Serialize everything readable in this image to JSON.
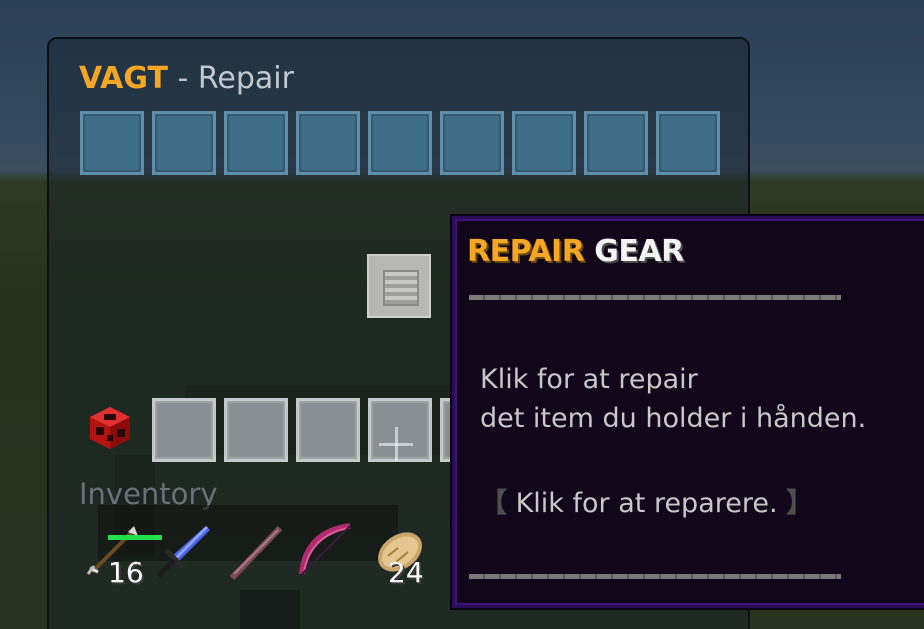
{
  "window": {
    "title_brand": "VAGT",
    "title_sep": "-",
    "title_sub": "Repair",
    "top_slot_count": 9
  },
  "center_button": {
    "icon": "stone-button-icon"
  },
  "inventory": {
    "label": "Inventory",
    "slot_count": 9,
    "side_icon": "tnt-icon"
  },
  "hotbar": {
    "items": [
      {
        "icon": "arrow-icon",
        "count": "16"
      },
      {
        "icon": "sword-icon",
        "durability": 1.0
      },
      {
        "icon": "stick-icon"
      },
      {
        "icon": "bow-icon"
      },
      {
        "icon": "bread-icon",
        "count": "24"
      }
    ]
  },
  "tooltip": {
    "title_part1": "REPAIR",
    "title_part2": "GEAR",
    "line1": "Klik for at repair",
    "line2": "det item du holder i hånden.",
    "action_open": "【",
    "action_text": "Klik for at reparere.",
    "action_close": "】"
  },
  "colors": {
    "brand": "#f5a623",
    "slot_blue": "#3f6d88",
    "slot_gray": "#8a8f93",
    "tooltip_bg": "#12061a",
    "tooltip_border": "#2a0c58",
    "durability": "#22e04a"
  }
}
